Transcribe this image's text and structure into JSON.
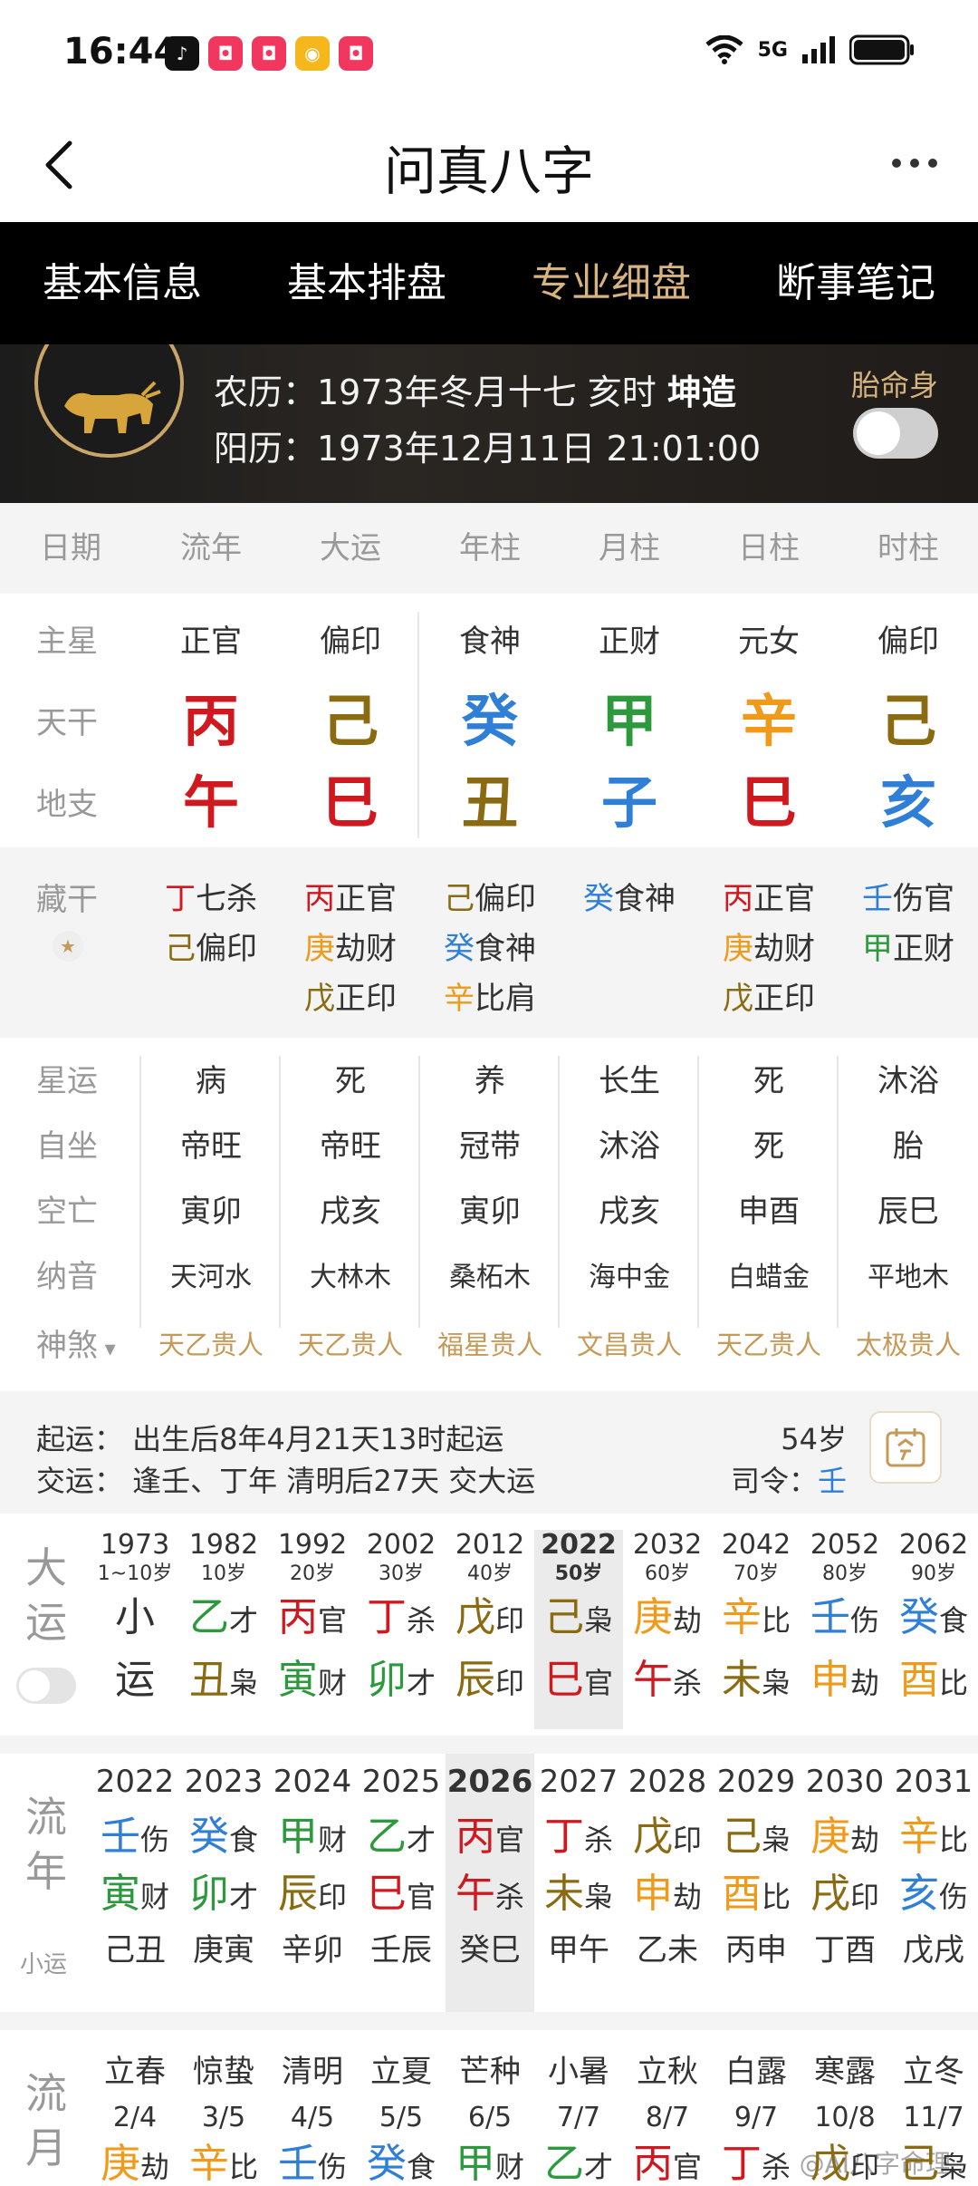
{
  "status": {
    "time": "16:44",
    "network": "5G"
  },
  "header": {
    "title": "问真八字"
  },
  "tabs": [
    {
      "label": "基本信息",
      "active": false
    },
    {
      "label": "基本排盘",
      "active": false
    },
    {
      "label": "专业细盘",
      "active": true
    },
    {
      "label": "断事笔记",
      "active": false
    }
  ],
  "birth": {
    "lunar_prefix": "农历：1973年冬月十七 亥时",
    "gender": "坤造",
    "solar": "阳历：1973年12月11日 21:01:00",
    "taiming_label": "胎命身",
    "taiming_on": false
  },
  "columns": [
    "日期",
    "流年",
    "大运",
    "年柱",
    "月柱",
    "日柱",
    "时柱"
  ],
  "row_labels": {
    "star": "主星",
    "gan": "天干",
    "zhi": "地支",
    "hidden": "藏干"
  },
  "pillars": [
    {
      "star": "正官",
      "gan": "丙",
      "gan_color": "#d0191f",
      "zhi": "午",
      "zhi_color": "#d0191f"
    },
    {
      "star": "偏印",
      "gan": "己",
      "gan_color": "#8a6b12",
      "zhi": "巳",
      "zhi_color": "#d0191f"
    },
    {
      "star": "食神",
      "gan": "癸",
      "gan_color": "#2f7fd6",
      "zhi": "丑",
      "zhi_color": "#8a6b12"
    },
    {
      "star": "正财",
      "gan": "甲",
      "gan_color": "#2c9a3c",
      "zhi": "子",
      "zhi_color": "#2f7fd6"
    },
    {
      "star": "元女",
      "gan": "辛",
      "gan_color": "#ef9a1a",
      "zhi": "巳",
      "zhi_color": "#d0191f"
    },
    {
      "star": "偏印",
      "gan": "己",
      "gan_color": "#8a6b12",
      "zhi": "亥",
      "zhi_color": "#2f7fd6"
    }
  ],
  "hidden_stems": [
    [
      {
        "g": "丁",
        "c": "#d0191f",
        "t": "七杀"
      },
      {
        "g": "己",
        "c": "#8a6b12",
        "t": "偏印"
      }
    ],
    [
      {
        "g": "丙",
        "c": "#d0191f",
        "t": "正官"
      },
      {
        "g": "庚",
        "c": "#ef9a1a",
        "t": "劫财"
      },
      {
        "g": "戊",
        "c": "#8a6b12",
        "t": "正印"
      }
    ],
    [
      {
        "g": "己",
        "c": "#8a6b12",
        "t": "偏印"
      },
      {
        "g": "癸",
        "c": "#2f7fd6",
        "t": "食神"
      },
      {
        "g": "辛",
        "c": "#ef9a1a",
        "t": "比肩"
      }
    ],
    [
      {
        "g": "癸",
        "c": "#2f7fd6",
        "t": "食神"
      }
    ],
    [
      {
        "g": "丙",
        "c": "#d0191f",
        "t": "正官"
      },
      {
        "g": "庚",
        "c": "#ef9a1a",
        "t": "劫财"
      },
      {
        "g": "戊",
        "c": "#8a6b12",
        "t": "正印"
      }
    ],
    [
      {
        "g": "壬",
        "c": "#2f7fd6",
        "t": "伤官"
      },
      {
        "g": "甲",
        "c": "#2c9a3c",
        "t": "正财"
      }
    ]
  ],
  "life_rows": [
    {
      "label": "星运",
      "values": [
        "病",
        "死",
        "养",
        "长生",
        "死",
        "沐浴"
      ]
    },
    {
      "label": "自坐",
      "values": [
        "帝旺",
        "帝旺",
        "冠带",
        "沐浴",
        "死",
        "胎"
      ]
    },
    {
      "label": "空亡",
      "values": [
        "寅卯",
        "戌亥",
        "寅卯",
        "戌亥",
        "申酉",
        "辰巳"
      ]
    },
    {
      "label": "纳音",
      "values": [
        "天河水",
        "大林木",
        "桑柘木",
        "海中金",
        "白蜡金",
        "平地木"
      ]
    }
  ],
  "shensha": {
    "label": "神煞",
    "values": [
      "天乙贵人",
      "天乙贵人",
      "福星贵人",
      "文昌贵人",
      "天乙贵人",
      "太极贵人"
    ]
  },
  "qiyun": {
    "line1": "起运：  出生后8年4月21天13时起运",
    "line2": "交运：  逢壬、丁年 清明后27天 交大运",
    "age": "54岁",
    "siling_label": "司令：",
    "siling_value": "壬"
  },
  "dayun": {
    "label": "大运",
    "cols": [
      {
        "year": "1973",
        "age": "1~10岁",
        "g": "小",
        "gc": "#333",
        "gt": "",
        "z": "运",
        "zc": "#333",
        "zt": "",
        "sel": false
      },
      {
        "year": "1982",
        "age": "10岁",
        "g": "乙",
        "gc": "#2c9a3c",
        "gt": "才",
        "z": "丑",
        "zc": "#8a6b12",
        "zt": "枭",
        "sel": false
      },
      {
        "year": "1992",
        "age": "20岁",
        "g": "丙",
        "gc": "#d0191f",
        "gt": "官",
        "z": "寅",
        "zc": "#2c9a3c",
        "zt": "财",
        "sel": false
      },
      {
        "year": "2002",
        "age": "30岁",
        "g": "丁",
        "gc": "#d0191f",
        "gt": "杀",
        "z": "卯",
        "zc": "#2c9a3c",
        "zt": "才",
        "sel": false
      },
      {
        "year": "2012",
        "age": "40岁",
        "g": "戊",
        "gc": "#8a6b12",
        "gt": "印",
        "z": "辰",
        "zc": "#8a6b12",
        "zt": "印",
        "sel": false
      },
      {
        "year": "2022",
        "age": "50岁",
        "g": "己",
        "gc": "#8a6b12",
        "gt": "枭",
        "z": "巳",
        "zc": "#d0191f",
        "zt": "官",
        "sel": true
      },
      {
        "year": "2032",
        "age": "60岁",
        "g": "庚",
        "gc": "#ef9a1a",
        "gt": "劫",
        "z": "午",
        "zc": "#d0191f",
        "zt": "杀",
        "sel": false
      },
      {
        "year": "2042",
        "age": "70岁",
        "g": "辛",
        "gc": "#ef9a1a",
        "gt": "比",
        "z": "未",
        "zc": "#8a6b12",
        "zt": "枭",
        "sel": false
      },
      {
        "year": "2052",
        "age": "80岁",
        "g": "壬",
        "gc": "#2f7fd6",
        "gt": "伤",
        "z": "申",
        "zc": "#ef9a1a",
        "zt": "劫",
        "sel": false
      },
      {
        "year": "2062",
        "age": "90岁",
        "g": "癸",
        "gc": "#2f7fd6",
        "gt": "食",
        "z": "酉",
        "zc": "#ef9a1a",
        "zt": "比",
        "sel": false
      }
    ]
  },
  "liunian": {
    "label": "流年",
    "sub_label": "小运",
    "cols": [
      {
        "year": "2022",
        "g": "壬",
        "gc": "#2f7fd6",
        "gt": "伤",
        "z": "寅",
        "zc": "#2c9a3c",
        "zt": "财",
        "x": "己丑",
        "sel": false
      },
      {
        "year": "2023",
        "g": "癸",
        "gc": "#2f7fd6",
        "gt": "食",
        "z": "卯",
        "zc": "#2c9a3c",
        "zt": "才",
        "x": "庚寅",
        "sel": false
      },
      {
        "year": "2024",
        "g": "甲",
        "gc": "#2c9a3c",
        "gt": "财",
        "z": "辰",
        "zc": "#8a6b12",
        "zt": "印",
        "x": "辛卯",
        "sel": false
      },
      {
        "year": "2025",
        "g": "乙",
        "gc": "#2c9a3c",
        "gt": "才",
        "z": "巳",
        "zc": "#d0191f",
        "zt": "官",
        "x": "壬辰",
        "sel": false
      },
      {
        "year": "2026",
        "g": "丙",
        "gc": "#d0191f",
        "gt": "官",
        "z": "午",
        "zc": "#d0191f",
        "zt": "杀",
        "x": "癸巳",
        "sel": true
      },
      {
        "year": "2027",
        "g": "丁",
        "gc": "#d0191f",
        "gt": "杀",
        "z": "未",
        "zc": "#8a6b12",
        "zt": "枭",
        "x": "甲午",
        "sel": false
      },
      {
        "year": "2028",
        "g": "戊",
        "gc": "#8a6b12",
        "gt": "印",
        "z": "申",
        "zc": "#ef9a1a",
        "zt": "劫",
        "x": "乙未",
        "sel": false
      },
      {
        "year": "2029",
        "g": "己",
        "gc": "#8a6b12",
        "gt": "枭",
        "z": "酉",
        "zc": "#ef9a1a",
        "zt": "比",
        "x": "丙申",
        "sel": false
      },
      {
        "year": "2030",
        "g": "庚",
        "gc": "#ef9a1a",
        "gt": "劫",
        "z": "戌",
        "zc": "#8a6b12",
        "zt": "印",
        "x": "丁酉",
        "sel": false
      },
      {
        "year": "2031",
        "g": "辛",
        "gc": "#ef9a1a",
        "gt": "比",
        "z": "亥",
        "zc": "#2f7fd6",
        "zt": "伤",
        "x": "戊戌",
        "sel": false
      }
    ]
  },
  "liuyue": {
    "label": "流月",
    "cols": [
      {
        "term": "立春",
        "date": "2/4",
        "g": "庚",
        "gc": "#ef9a1a",
        "gt": "劫"
      },
      {
        "term": "惊蛰",
        "date": "3/5",
        "g": "辛",
        "gc": "#ef9a1a",
        "gt": "比"
      },
      {
        "term": "清明",
        "date": "4/5",
        "g": "壬",
        "gc": "#2f7fd6",
        "gt": "伤"
      },
      {
        "term": "立夏",
        "date": "5/5",
        "g": "癸",
        "gc": "#2f7fd6",
        "gt": "食"
      },
      {
        "term": "芒种",
        "date": "6/5",
        "g": "甲",
        "gc": "#2c9a3c",
        "gt": "财"
      },
      {
        "term": "小暑",
        "date": "7/7",
        "g": "乙",
        "gc": "#2c9a3c",
        "gt": "才"
      },
      {
        "term": "立秋",
        "date": "8/7",
        "g": "丙",
        "gc": "#d0191f",
        "gt": "官"
      },
      {
        "term": "白露",
        "date": "9/7",
        "g": "丁",
        "gc": "#d0191f",
        "gt": "杀"
      },
      {
        "term": "寒露",
        "date": "10/8",
        "g": "戊",
        "gc": "#8a6b12",
        "gt": "印"
      },
      {
        "term": "立冬",
        "date": "11/7",
        "g": "己",
        "gc": "#8a6b12",
        "gt": "枭"
      }
    ]
  },
  "watermark": "@AI八字命理"
}
